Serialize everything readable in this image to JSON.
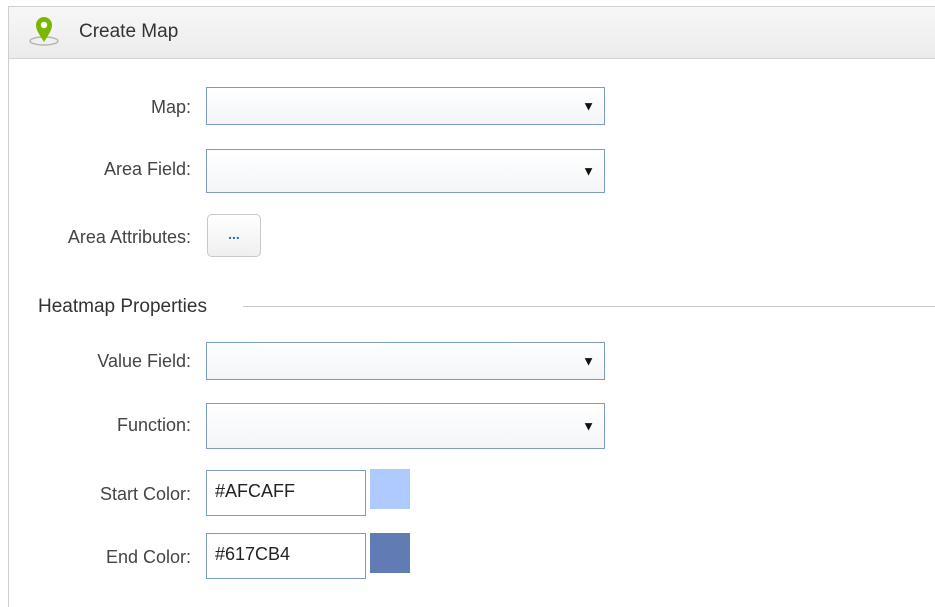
{
  "panel": {
    "title": "Create Map",
    "icon": "map-pin-icon"
  },
  "form": {
    "map": {
      "label": "Map:",
      "value": ""
    },
    "area_field": {
      "label": "Area Field:",
      "value": ""
    },
    "area_attributes": {
      "label": "Area Attributes:",
      "button_label": "..."
    }
  },
  "heatmap": {
    "section_title": "Heatmap Properties",
    "value_field": {
      "label": "Value Field:",
      "value": ""
    },
    "function": {
      "label": "Function:",
      "value": ""
    },
    "start_color": {
      "label": "Start Color:",
      "value": "#AFCAFF",
      "swatch": "#AFCAFF"
    },
    "end_color": {
      "label": "End Color:",
      "value": "#617CB4",
      "swatch": "#617CB4"
    }
  },
  "colors": {
    "input_border": "#7A9CC9",
    "icon_green": "#7AB800"
  }
}
